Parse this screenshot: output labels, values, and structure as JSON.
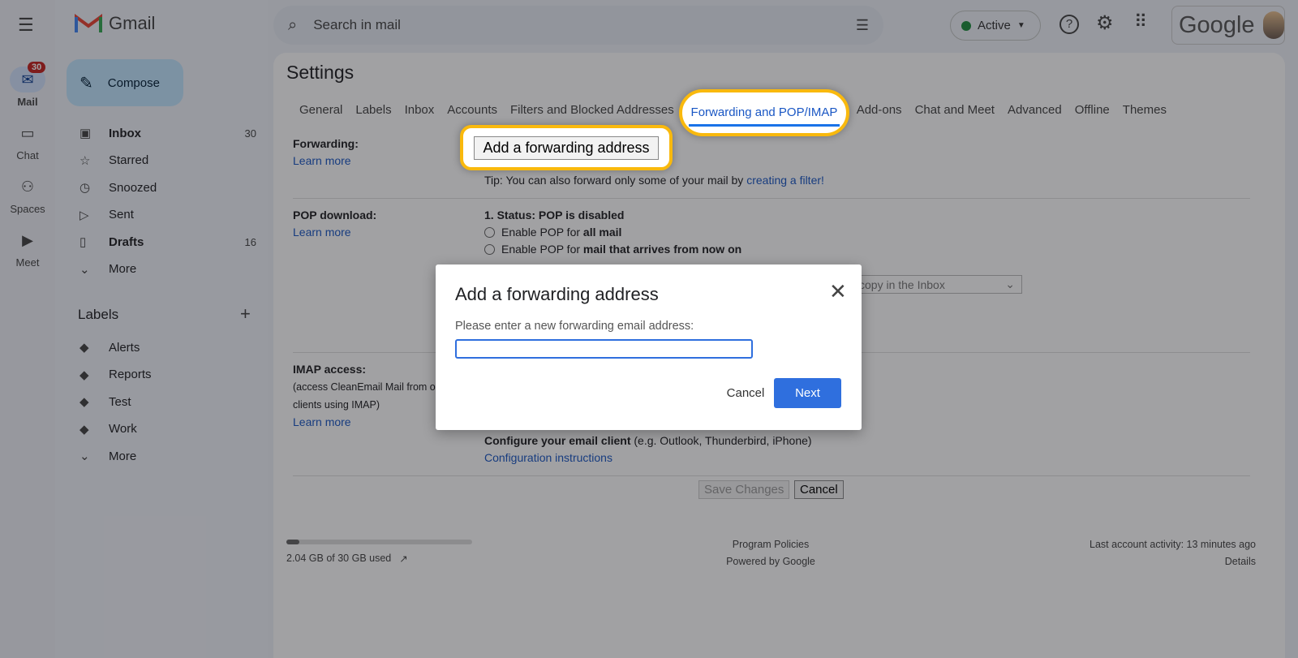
{
  "app": {
    "name": "Gmail"
  },
  "rail": [
    {
      "label": "Mail",
      "icon": "mail-icon",
      "badge": "30"
    },
    {
      "label": "Chat",
      "icon": "chat-icon"
    },
    {
      "label": "Spaces",
      "icon": "spaces-icon"
    },
    {
      "label": "Meet",
      "icon": "meet-icon"
    }
  ],
  "compose": "Compose",
  "nav": [
    {
      "label": "Inbox",
      "count": "30",
      "bold": true,
      "icon": "inbox-icon"
    },
    {
      "label": "Starred",
      "icon": "star-icon"
    },
    {
      "label": "Snoozed",
      "icon": "clock-icon"
    },
    {
      "label": "Sent",
      "icon": "send-icon"
    },
    {
      "label": "Drafts",
      "count": "16",
      "bold": true,
      "icon": "draft-icon"
    },
    {
      "label": "More",
      "icon": "chevron-down-icon"
    }
  ],
  "labels": {
    "title": "Labels",
    "items": [
      "Alerts",
      "Reports",
      "Test",
      "Work"
    ],
    "more": "More"
  },
  "search": {
    "placeholder": "Search in mail"
  },
  "header": {
    "status": "Active",
    "status_color": "#1e8e3e",
    "brand": "Google"
  },
  "settings": {
    "title": "Settings",
    "tabs": [
      "General",
      "Labels",
      "Inbox",
      "Accounts",
      "Filters and Blocked Addresses",
      "Forwarding and POP/IMAP",
      "Add-ons",
      "Chat and Meet",
      "Advanced",
      "Offline",
      "Themes"
    ],
    "active_tab": "Forwarding and POP/IMAP",
    "forwarding": {
      "label": "Forwarding:",
      "learn": "Learn more",
      "button": "Add a forwarding address",
      "tip": "Tip: You can also forward only some of your mail by ",
      "tip_link": "creating a filter!"
    },
    "pop": {
      "label": "POP download:",
      "learn": "Learn more",
      "status": "1. Status: POP is disabled",
      "opt1": "Enable POP for ",
      "opt1b": "all mail",
      "opt2": "Enable POP for ",
      "opt2b": "mail that arrives from now on",
      "select": "copy in the Inbox"
    },
    "imap": {
      "label": "IMAP access:",
      "desc1": "(access CleanEmail Mail from o",
      "desc2": "clients using IMAP)",
      "learn": "Learn more",
      "configure_b": "Configure your email client",
      "configure": " (e.g. Outlook, Thunderbird, iPhone)",
      "instructions": "Configuration instructions"
    },
    "save": "Save Changes",
    "cancel": "Cancel"
  },
  "footer": {
    "storage": "2.04 GB of 30 GB used",
    "storage_fraction": 0.068,
    "policies": "Program Policies",
    "powered": "Powered by Google",
    "activity": "Last account activity: 13 minutes ago",
    "details": "Details"
  },
  "dialog": {
    "title": "Add a forwarding address",
    "prompt": "Please enter a new forwarding email address:",
    "value": "",
    "cancel": "Cancel",
    "next": "Next",
    "accent": "#2f6fde"
  },
  "highlight_color": "#f9b90d"
}
